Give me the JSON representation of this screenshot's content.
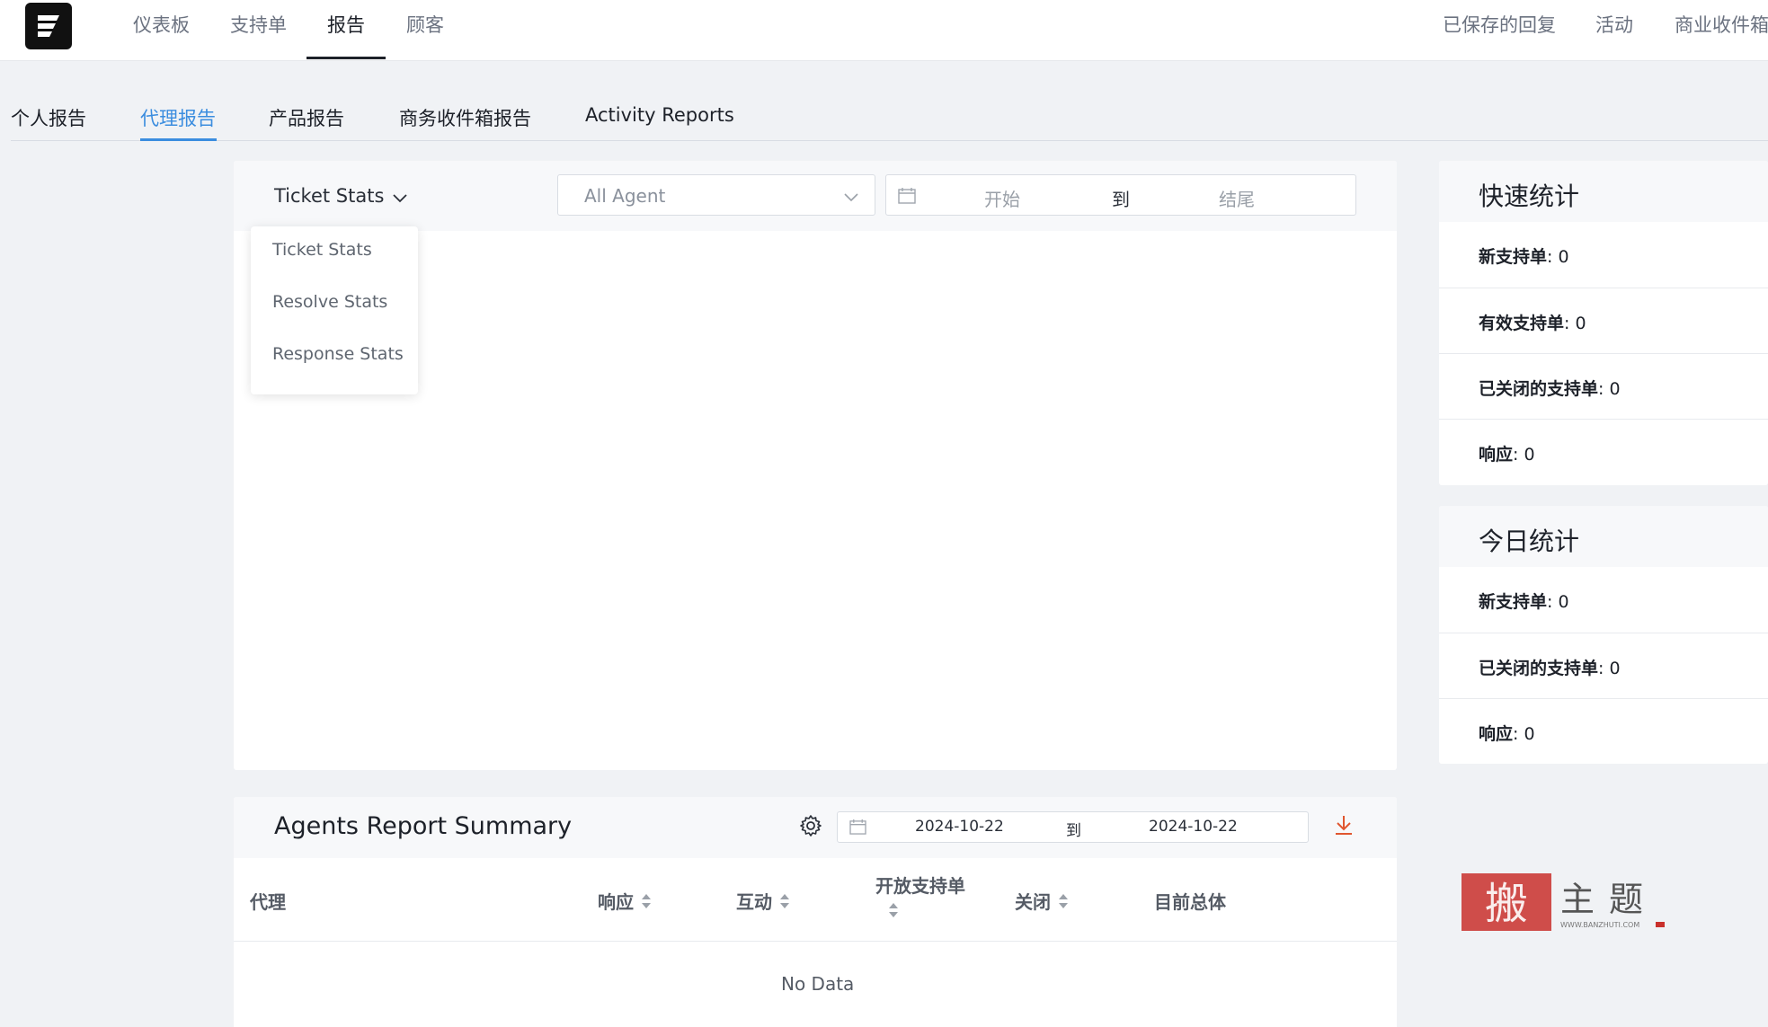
{
  "top_nav": {
    "items": [
      {
        "label": "仪表板"
      },
      {
        "label": "支持单"
      },
      {
        "label": "报告"
      },
      {
        "label": "顾客"
      }
    ],
    "right_items": [
      {
        "label": "已保存的回复"
      },
      {
        "label": "活动"
      },
      {
        "label": "商业收件箱"
      }
    ]
  },
  "sub_tabs": [
    {
      "label": "个人报告"
    },
    {
      "label": "代理报告"
    },
    {
      "label": "产品报告"
    },
    {
      "label": "商务收件箱报告"
    },
    {
      "label": "Activity Reports"
    }
  ],
  "report_panel": {
    "stats_selector": "Ticket Stats",
    "stats_options": [
      "Ticket Stats",
      "Resolve Stats",
      "Response Stats"
    ],
    "agent_placeholder": "All Agent",
    "date_start_placeholder": "开始",
    "date_separator": "到",
    "date_end_placeholder": "结尾"
  },
  "quick_stats": {
    "title": "快速统计",
    "rows": [
      {
        "label": "新支持单",
        "value": ": 0"
      },
      {
        "label": "有效支持单",
        "value": ": 0"
      },
      {
        "label": "已关闭的支持单",
        "value": ": 0"
      },
      {
        "label": "响应",
        "value": ": 0"
      }
    ]
  },
  "today_stats": {
    "title": "今日统计",
    "rows": [
      {
        "label": "新支持单",
        "value": ": 0"
      },
      {
        "label": "已关闭的支持单",
        "value": ": 0"
      },
      {
        "label": "响应",
        "value": ": 0"
      }
    ]
  },
  "summary": {
    "title": "Agents Report Summary",
    "date_from": "2024-10-22",
    "date_separator": "到",
    "date_to": "2024-10-22",
    "columns": [
      {
        "label": "代理"
      },
      {
        "label": "响应"
      },
      {
        "label": "互动"
      },
      {
        "label": "开放支持单"
      },
      {
        "label": "关闭"
      },
      {
        "label": "目前总体"
      }
    ],
    "empty_text": "No Data"
  },
  "watermark": {
    "text": "搬主题",
    "url_text": "WWW.BANZHUTI.COM"
  },
  "colors": {
    "accent": "#3b8ddf",
    "background": "#f0f2f5",
    "download_icon": "#e0562f",
    "watermark": "#c9302c"
  }
}
